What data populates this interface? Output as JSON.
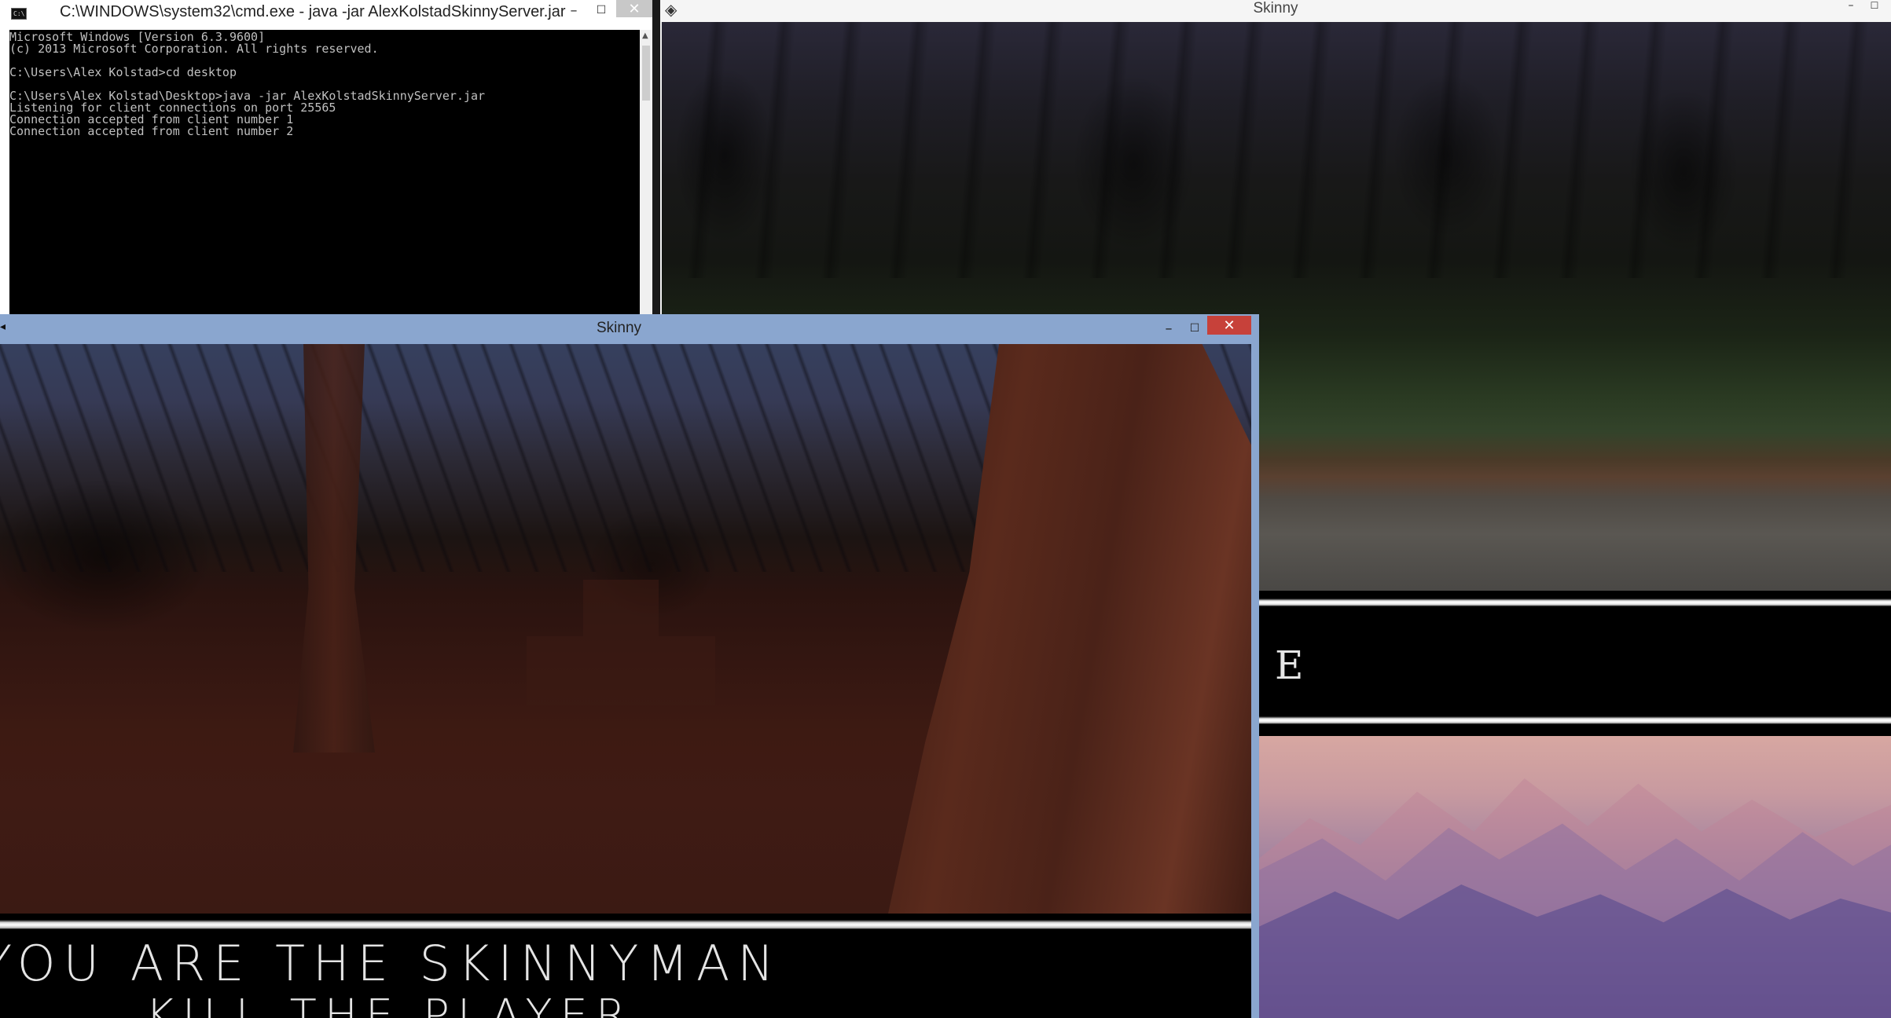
{
  "cmd": {
    "title": "C:\\WINDOWS\\system32\\cmd.exe - java  -jar AlexKolstadSkinnyServer.jar",
    "console_lines": [
      "Microsoft Windows [Version 6.3.9600]",
      "(c) 2013 Microsoft Corporation. All rights reserved.",
      "",
      "C:\\Users\\Alex Kolstad>cd desktop",
      "",
      "C:\\Users\\Alex Kolstad\\Desktop>java -jar AlexKolstadSkinnyServer.jar",
      "Listening for client connections on port 25565",
      "Connection accepted from client number 1",
      "Connection accepted from client number 2"
    ],
    "buttons": {
      "minimize": "–",
      "maximize": "☐",
      "close": "✕"
    }
  },
  "skinny_back": {
    "title": "Skinny",
    "hud_letter": "E",
    "buttons": {
      "minimize": "–",
      "maximize": "☐"
    }
  },
  "skinny_front": {
    "title": "Skinny",
    "message_line1": "YOU ARE THE SKINNYMAN",
    "message_line2": "KILL THE PLAYER",
    "buttons": {
      "minimize": "–",
      "maximize": "☐",
      "close": "✕"
    }
  },
  "colors": {
    "active_titlebar": "#8aa6cf",
    "close_red": "#c7413a",
    "console_bg": "#000000",
    "console_text": "#c0c0c0"
  }
}
